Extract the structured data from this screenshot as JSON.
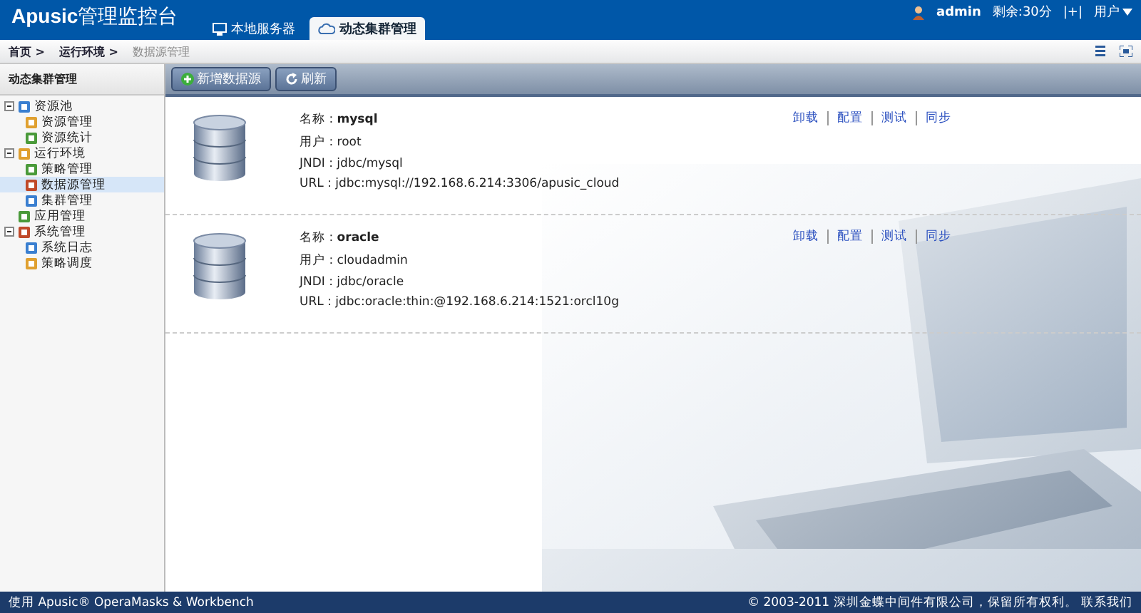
{
  "header": {
    "logo": "Apusic",
    "logo_suffix": "管理监控台",
    "tabs": [
      {
        "label": "本地服务器",
        "selected": false
      },
      {
        "label": "动态集群管理",
        "selected": true
      }
    ],
    "user": "admin",
    "remaining": "剩余:30分",
    "extend": "|+|",
    "user_menu": "用户"
  },
  "breadcrumb": [
    {
      "label": "首页 >",
      "current": false
    },
    {
      "label": "运行环境 >",
      "current": false
    },
    {
      "label": "数据源管理",
      "current": true
    }
  ],
  "sidebar": {
    "title": "动态集群管理",
    "items": [
      {
        "label": "资源池",
        "expanded": true,
        "selected": false,
        "children": [
          {
            "label": "资源管理",
            "selected": false
          },
          {
            "label": "资源统计",
            "selected": false
          }
        ]
      },
      {
        "label": "运行环境",
        "expanded": true,
        "selected": false,
        "children": [
          {
            "label": "策略管理",
            "selected": false
          },
          {
            "label": "数据源管理",
            "selected": true
          },
          {
            "label": "集群管理",
            "selected": false
          }
        ]
      },
      {
        "label": "应用管理",
        "selected": false
      },
      {
        "label": "系统管理",
        "expanded": true,
        "selected": false,
        "children": [
          {
            "label": "系统日志",
            "selected": false
          },
          {
            "label": "策略调度",
            "selected": false
          }
        ]
      }
    ]
  },
  "toolbar": [
    {
      "kind": "add",
      "label": "新增数据源"
    },
    {
      "kind": "refresh",
      "label": "刷新"
    }
  ],
  "datasources": [
    {
      "lines": [
        "名称 : **mysql**",
        "用户 : root",
        "JNDI : jdbc/mysql",
        "URL : jdbc:mysql://192.168.6.214:3306/apusic_cloud"
      ],
      "actions": [
        "卸载",
        "配置",
        "测试",
        "同步"
      ]
    },
    {
      "lines": [
        "名称 : **oracle**",
        "用户 : cloudadmin",
        "JNDI : jdbc/oracle",
        "URL : jdbc:oracle:thin:@192.168.6.214:1521:orcl10g"
      ],
      "actions": [
        "卸载",
        "配置",
        "测试",
        "同步"
      ]
    }
  ],
  "footer": {
    "left": "使用 Apusic® OperaMasks & Workbench",
    "right": "© 2003-2011 深圳金蝶中间件有限公司，保留所有权利。 联系我们"
  }
}
